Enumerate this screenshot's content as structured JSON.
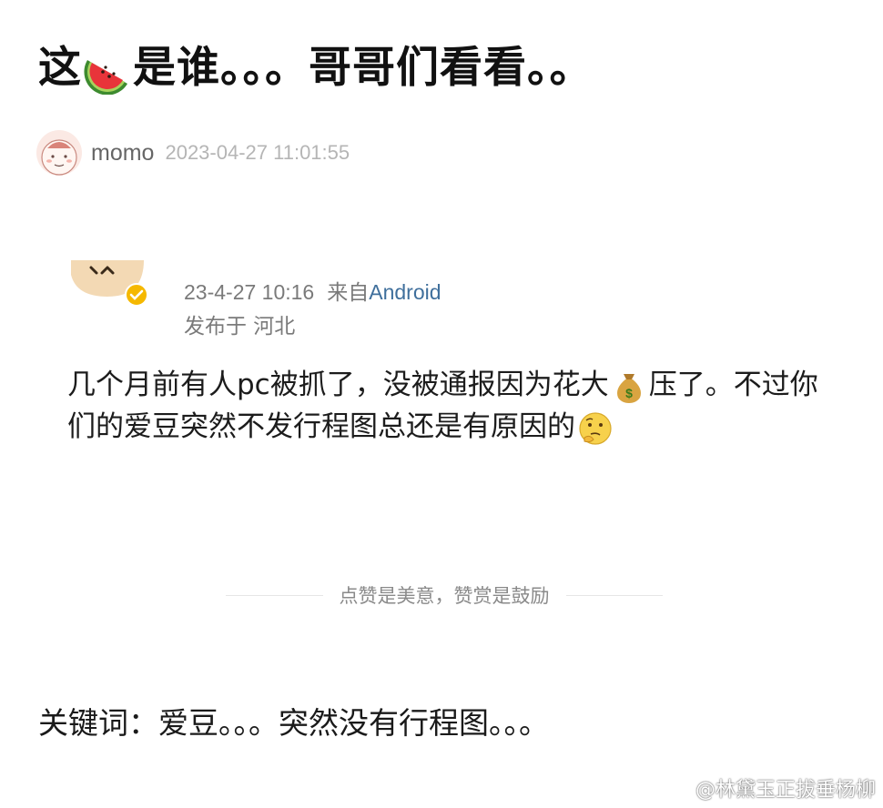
{
  "post": {
    "title_part1": "这",
    "title_part2": "是谁。。。哥哥们看看。。",
    "title_emoji": "watermelon-emoji"
  },
  "poster": {
    "name": "momo",
    "time": "2023-04-27 11:01:55",
    "avatar": "cartoon-face-avatar"
  },
  "quoted": {
    "time": "23-4-27 10:16",
    "from_label": "来自",
    "source": "Android",
    "location": "发布于 河北",
    "body_part1": "几个月前有人pc被抓了，没被通报因为花大",
    "body_emoji1": "money-bag-emoji",
    "body_part2": "压了。不过你们的爱豆突然不发行程图总还是有原因的",
    "body_emoji2": "thinking-face-emoji",
    "reward_text": "点赞是美意，赞赏是鼓励",
    "verified_badge": "verified-badge-icon"
  },
  "keywords_line": "关键词：爱豆。。。突然没有行程图。。。",
  "watermark": {
    "text": "@林黛玉正拔垂杨柳",
    "icon": "weibo-logo-icon"
  },
  "colors": {
    "meta_gray": "#7a7a7a",
    "source_blue": "#3f6f9c",
    "timestamp_gray": "#b5b5b5",
    "verified_gold": "#f5b800"
  }
}
